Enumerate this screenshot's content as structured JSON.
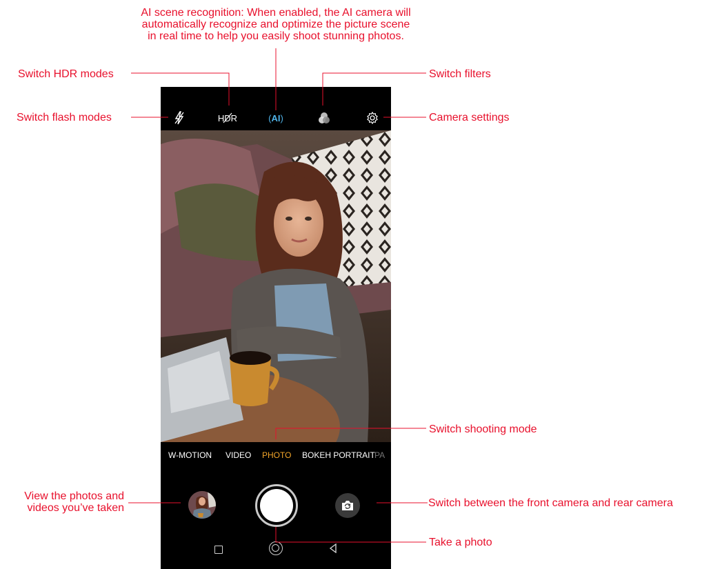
{
  "phone": {
    "topbar": {
      "flash_icon": "flash-off-icon",
      "hdr_label": "HDR",
      "ai_label": "AI",
      "filter_icon": "filters-icon",
      "settings_icon": "gear-icon"
    },
    "modes": [
      "W-MOTION",
      "VIDEO",
      "PHOTO",
      "BOKEH PORTRAIT",
      "PA"
    ],
    "active_mode": "PHOTO",
    "controls": {
      "gallery_icon": "gallery-thumbnail",
      "shutter_icon": "shutter-button",
      "switch_camera_icon": "switch-camera-icon"
    },
    "nav": {
      "recent_icon": "square-icon",
      "home_icon": "home-circle-icon",
      "back_icon": "back-triangle-icon"
    }
  },
  "callouts": {
    "ai_scene": [
      "AI scene recognition: When enabled, the AI camera will",
      "automatically recognize and optimize the picture scene",
      "in real time to help you easily shoot stunning photos."
    ],
    "hdr": "Switch HDR modes",
    "flash": "Switch flash modes",
    "filters": "Switch filters",
    "settings": "Camera settings",
    "shooting_mode": "Switch shooting mode",
    "gallery": [
      "View the photos and",
      "videos you’ve taken"
    ],
    "switch_camera": "Switch between the front camera and rear camera",
    "take_photo": "Take a photo"
  },
  "colors": {
    "callout": "#e8102c",
    "active_mode": "#f2a52a",
    "ai_accent": "#4fb3e8"
  }
}
